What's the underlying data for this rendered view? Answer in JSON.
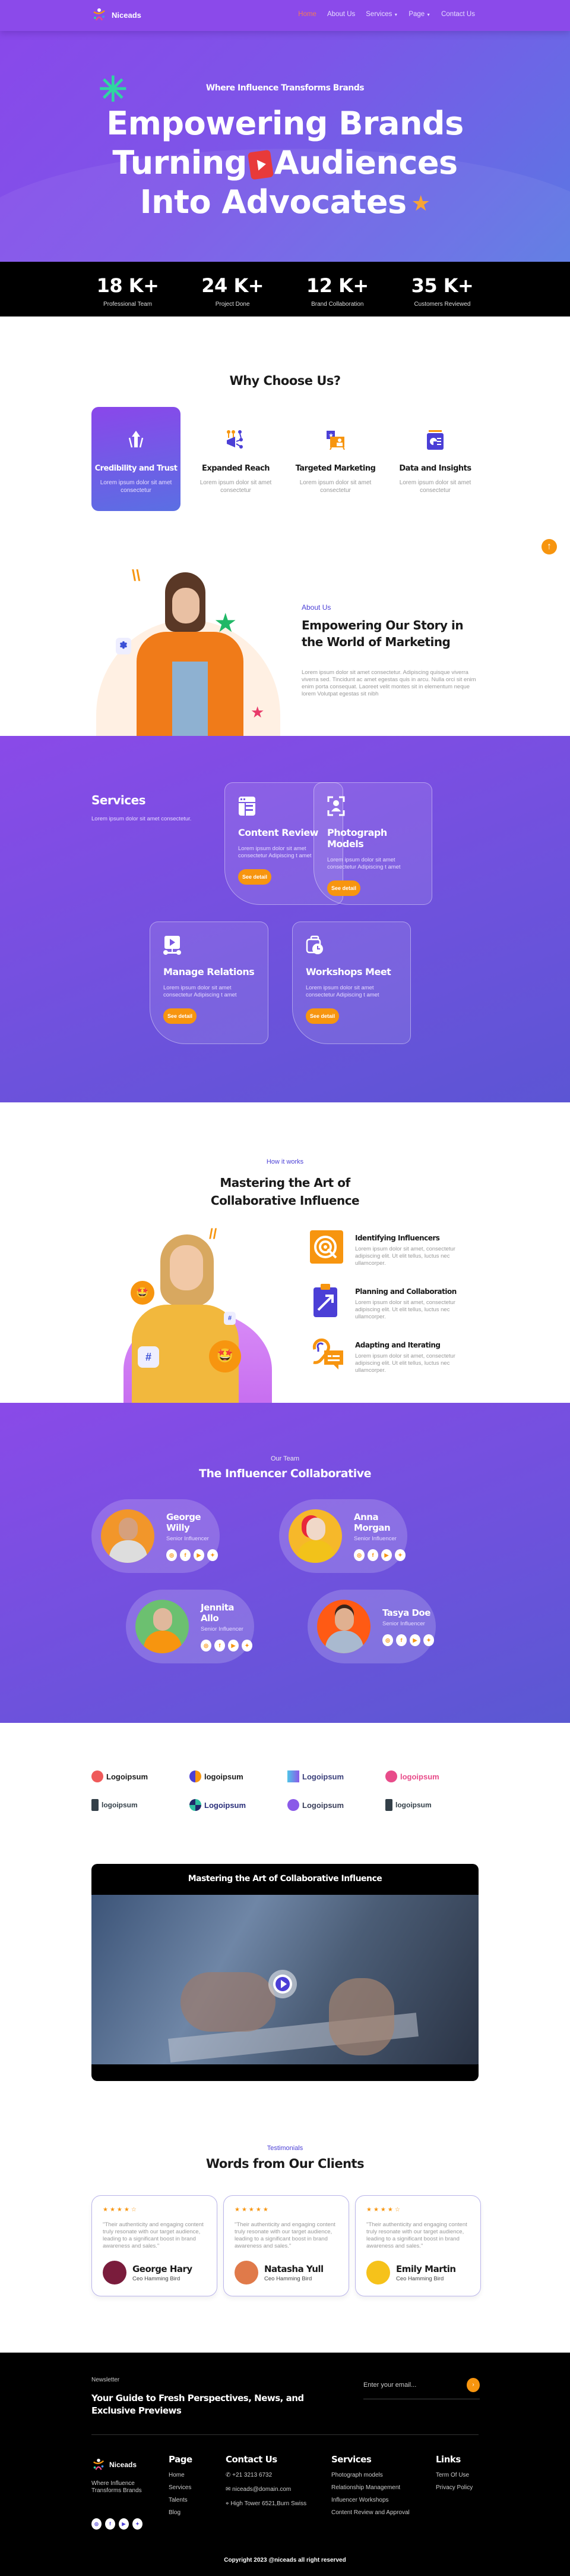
{
  "nav": {
    "brand": "Niceads",
    "items": [
      {
        "label": "Home",
        "active": true,
        "dropdown": false
      },
      {
        "label": "About Us",
        "active": false,
        "dropdown": false
      },
      {
        "label": "Services",
        "active": false,
        "dropdown": true
      },
      {
        "label": "Page",
        "active": false,
        "dropdown": true
      },
      {
        "label": "Contact Us",
        "active": false,
        "dropdown": false
      }
    ]
  },
  "hero": {
    "tagline": "Where Influence Transforms Brands",
    "title_line1": "Empowering Brands",
    "title_line2a": "Turning",
    "title_line2b": "Audiences",
    "title_line3": "Into Advocates"
  },
  "stats": [
    {
      "value": "18 K+",
      "label": "Professional Team"
    },
    {
      "value": "24 K+",
      "label": "Project Done"
    },
    {
      "value": "12 K+",
      "label": "Brand Collaboration"
    },
    {
      "value": "35 K+",
      "label": "Customers Reviewed"
    }
  ],
  "why": {
    "title": "Why Choose Us?",
    "cards": [
      {
        "title": "Credibility and Trust",
        "text": "Lorem ipsum dolor sit amet consectetur",
        "icon": "arrow-up-icon",
        "active": true
      },
      {
        "title": "Expanded Reach",
        "text": "Lorem ipsum dolor sit amet consectetur",
        "icon": "megaphone-network-icon",
        "active": false
      },
      {
        "title": "Targeted Marketing",
        "text": "Lorem ipsum dolor sit amet consectetur",
        "icon": "target-audience-icon",
        "active": false
      },
      {
        "title": "Data and Insights",
        "text": "Lorem ipsum dolor sit amet consectetur",
        "icon": "data-report-icon",
        "active": false
      }
    ]
  },
  "about": {
    "eyebrow": "About Us",
    "title": "Empowering Our Story in the World of Marketing",
    "text": "Lorem ipsum dolor sit amet consectetur. Adipiscing quisque viverra viverra sed. Tincidunt ac amet egestas quis in arcu. Nulla orci sit enim enim porta consequat. Laoreet velit montes sit in elementum neque lorem Volutpat egestas sit nibh"
  },
  "scroll_top": "↑",
  "services": {
    "title": "Services",
    "subtitle": "Lorem ipsum dolor sit amet consectetur.",
    "cards": [
      {
        "title": "Content Review",
        "text": "Lorem ipsum dolor sit amet consectetur Adipiscing t amet",
        "button": "See detail",
        "icon": "content-window-icon"
      },
      {
        "title": "Photograph Models",
        "text": "Lorem ipsum dolor sit amet consectetur Adipiscing t amet",
        "button": "See detail",
        "icon": "portrait-focus-icon"
      },
      {
        "title": "Manage Relations",
        "text": "Lorem ipsum dolor sit amet consectetur Adipiscing t amet",
        "button": "See detail",
        "icon": "video-network-icon"
      },
      {
        "title": "Workshops Meet",
        "text": "Lorem ipsum dolor sit amet consectetur Adipiscing t amet",
        "button": "See detail",
        "icon": "briefcase-clock-icon"
      }
    ]
  },
  "how": {
    "eyebrow": "How it works",
    "title": "Mastering the Art of Collaborative Influence",
    "steps": [
      {
        "title": "Identifying Influencers",
        "text": "Lorem ipsum dolor sit amet, consectetur adipiscing elit. Ut elit tellus, luctus nec ullamcorper.",
        "icon": "target-click-icon",
        "color": "#f7950f"
      },
      {
        "title": "Planning and Collaboration",
        "text": "Lorem ipsum dolor sit amet, consectetur adipiscing elit. Ut elit tellus, luctus nec ullamcorper.",
        "icon": "clipboard-arrow-icon",
        "color": "#4b3fd6"
      },
      {
        "title": "Adapting and Iterating",
        "text": "Lorem ipsum dolor sit amet, consectetur adipiscing elit. Ut elit tellus, luctus nec ullamcorper.",
        "icon": "ear-chat-icon",
        "color": "#f7950f"
      }
    ]
  },
  "team": {
    "eyebrow": "Our Team",
    "title": "The Influencer Collaborative",
    "members": [
      {
        "name": "George Willy",
        "role": "Senior Influencer",
        "bg": "#f2962a"
      },
      {
        "name": "Anna Morgan",
        "role": "Senior Influencer",
        "bg": "#f6b82a"
      },
      {
        "name": "Jennita Allo",
        "role": "Senior Influencer",
        "bg": "#6cc070"
      },
      {
        "name": "Tasya Doe",
        "role": "Senior Influencer",
        "bg": "#ff5a14"
      }
    ],
    "socials": [
      "instagram-icon",
      "facebook-icon",
      "youtube-icon",
      "twitter-icon"
    ]
  },
  "logos": [
    {
      "text": "Logoipsum",
      "color": "#ef5a5a"
    },
    {
      "text": "logoipsum",
      "color": "#f7950f"
    },
    {
      "text": "Logoipsum",
      "color": "#6e7ae0"
    },
    {
      "text": "logoipsum",
      "color": "#e84c8a"
    },
    {
      "text": "logoipsum",
      "color": "#333f48"
    },
    {
      "text": "Logoipsum",
      "color": "#2fbfa0"
    },
    {
      "text": "Logoipsum",
      "color": "#8a5ae8"
    },
    {
      "text": "logoipsum",
      "color": "#333f48"
    }
  ],
  "video": {
    "title": "Mastering the Art of Collaborative Influence"
  },
  "testimonials": {
    "eyebrow": "Testimonials",
    "title": "Words from Our Clients",
    "items": [
      {
        "rating": 4,
        "quote": "\"Their authenticity and engaging content truly resonate with our target audience, leading to a significant boost in brand awareness and sales.\"",
        "name": "George Hary",
        "position": "Ceo Hamming Bird",
        "avatar_bg": "#7a1c3c"
      },
      {
        "rating": 5,
        "quote": "\"Their authenticity and engaging content truly resonate with our target audience, leading to a significant boost in brand awareness and sales.\"",
        "name": "Natasha Yull",
        "position": "Ceo Hamming Bird",
        "avatar_bg": "#e07a4a"
      },
      {
        "rating": 4,
        "quote": "\"Their authenticity and engaging content truly resonate with our target audience, leading to a significant boost in brand awareness and sales.\"",
        "name": "Emily Martin",
        "position": "Ceo Hamming Bird",
        "avatar_bg": "#f6c21a"
      }
    ]
  },
  "footer": {
    "newsletter_label": "Newsletter",
    "newsletter_title": "Your Guide to Fresh Perspectives, News, and Exclusive Previews",
    "email_placeholder": "Enter your email...",
    "submit": "›",
    "brand": "Niceads",
    "brand_tagline": "Where Influence Transforms Brands",
    "page": {
      "title": "Page",
      "links": [
        "Home",
        "Services",
        "Talents",
        "Blog"
      ]
    },
    "contact": {
      "title": "Contact Us",
      "phone": "+21 3213 6732",
      "email": "niceads@domain.com",
      "address": "High Tower 6521,Burn Swiss"
    },
    "services": {
      "title": "Services",
      "links": [
        "Photograph models",
        "Relationship Management",
        "Influencer Workshops",
        "Content Review and Approval"
      ]
    },
    "links": {
      "title": "Links",
      "links": [
        "Term Of Use",
        "Privacy Policy"
      ]
    },
    "copyright": "Copyright 2023 @niceads all right reserved"
  }
}
